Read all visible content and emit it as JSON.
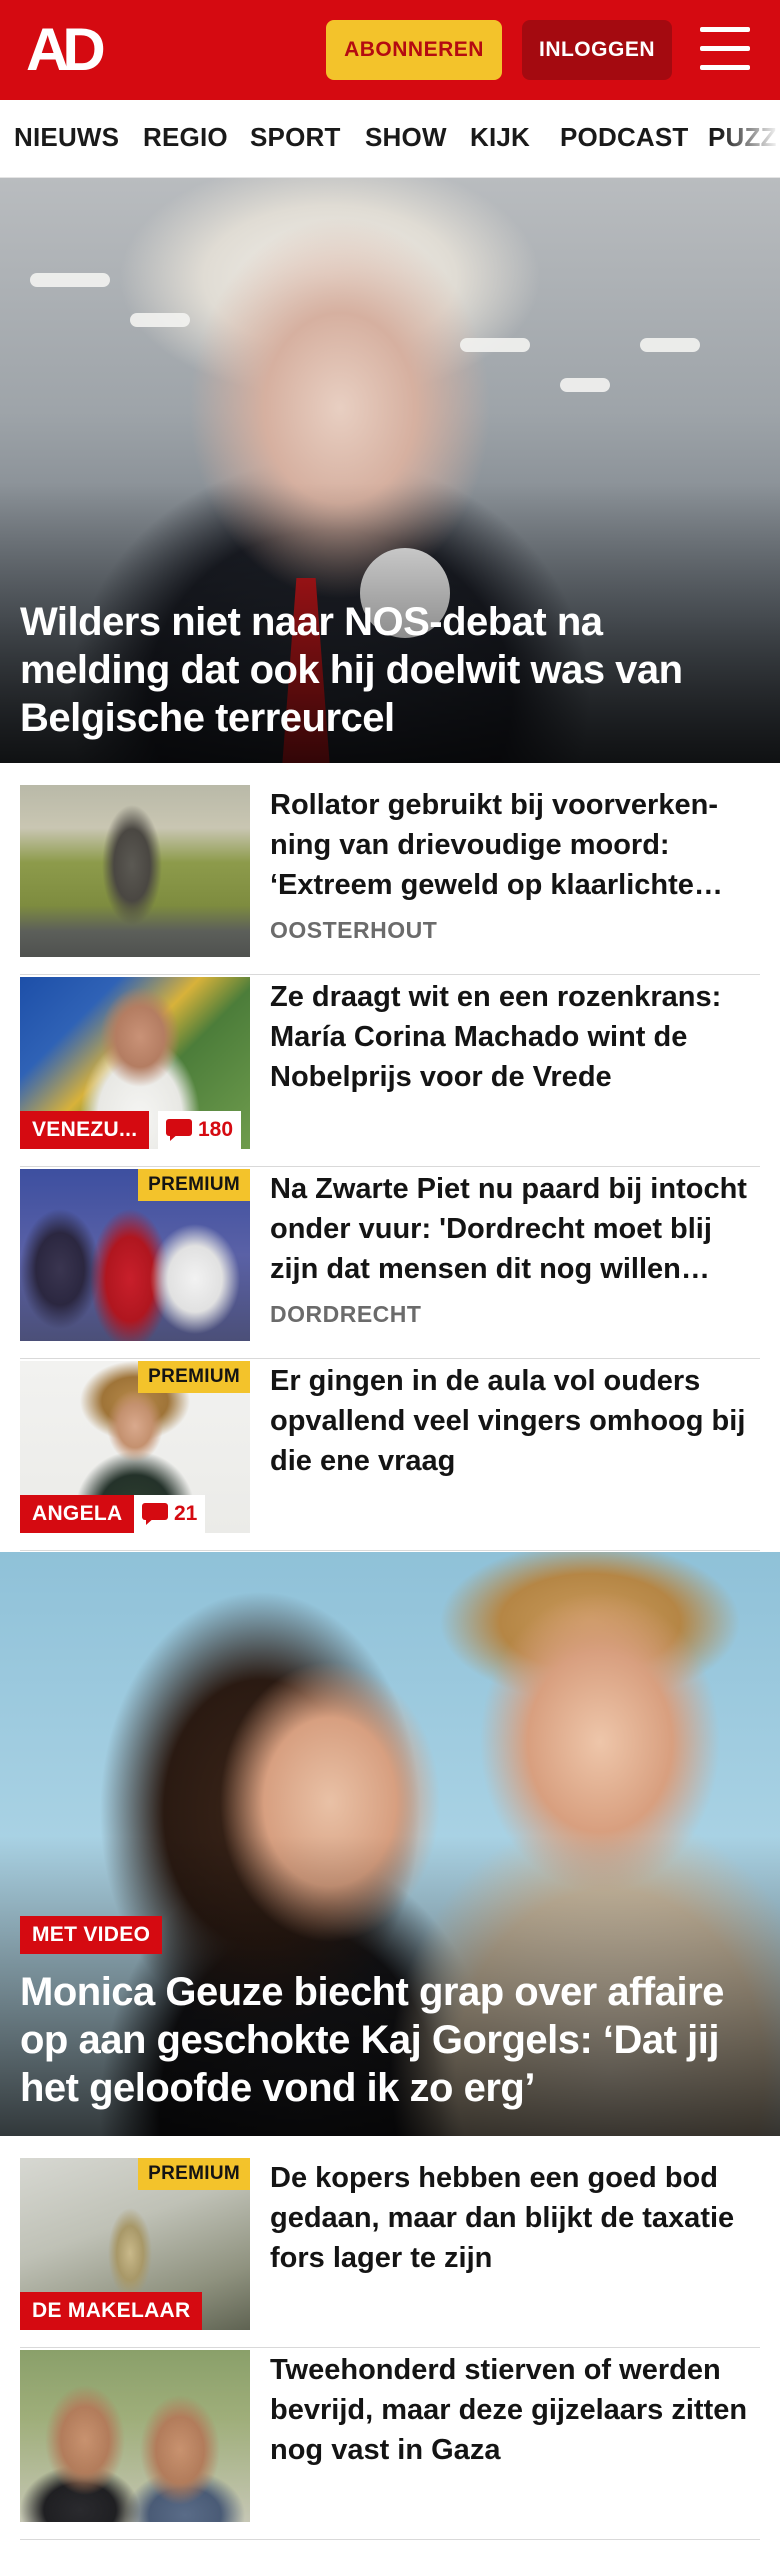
{
  "header": {
    "logo_text": "AD",
    "subscribe_label": "ABONNEREN",
    "login_label": "INLOGGEN",
    "menu_icon": "hamburger-menu-icon",
    "brand_color": "#d50a11",
    "accent_color": "#f3c32b"
  },
  "nav": {
    "items": [
      {
        "label": "NIEUWS"
      },
      {
        "label": "REGIO"
      },
      {
        "label": "SPORT"
      },
      {
        "label": "SHOW"
      },
      {
        "label": "KIJK"
      },
      {
        "label": "PODCAST"
      },
      {
        "label": "PUZZ"
      }
    ]
  },
  "hero1": {
    "title": "Wilders niet naar NOS-debat na melding dat ook hij doelwit was van Belgische terreurcel"
  },
  "articles1": [
    {
      "title": "Rollator gebruikt bij voorverken­ning van drievoudige moord: ‘Extreem geweld op klaarlichte dag’",
      "location": "OOSTERHOUT"
    },
    {
      "title": "Ze draagt wit en een rozenkrans: María Corina Machado wint de Nobelprijs voor de Vrede",
      "label": "VENEZU...",
      "comments": "180"
    },
    {
      "title": "Na Zwarte Piet nu paard bij intocht onder vuur: 'Dordrecht moet blij zijn dat mensen dit nog willen doen'",
      "location": "DORDRECHT",
      "premium": "PREMIUM"
    },
    {
      "title": "Er gingen in de aula vol ouders opvallend veel vingers omhoog bij die ene vraag",
      "label": "ANGELA",
      "comments": "21",
      "premium": "PREMIUM"
    }
  ],
  "hero2": {
    "label": "MET VIDEO",
    "title": "Monica Geuze biecht grap over affaire op aan geschokte Kaj Gorgels: ‘Dat jij het geloofde vond ik zo erg’"
  },
  "articles2": [
    {
      "title": "De kopers hebben een goed bod gedaan, maar dan blijkt de taxatie fors lager te zijn",
      "label": "DE MAKELAAR",
      "premium": "PREMIUM"
    },
    {
      "title": "Tweehonderd stierven of werden bevrijd, maar deze gijzelaars zitten nog vast in Gaza"
    }
  ]
}
